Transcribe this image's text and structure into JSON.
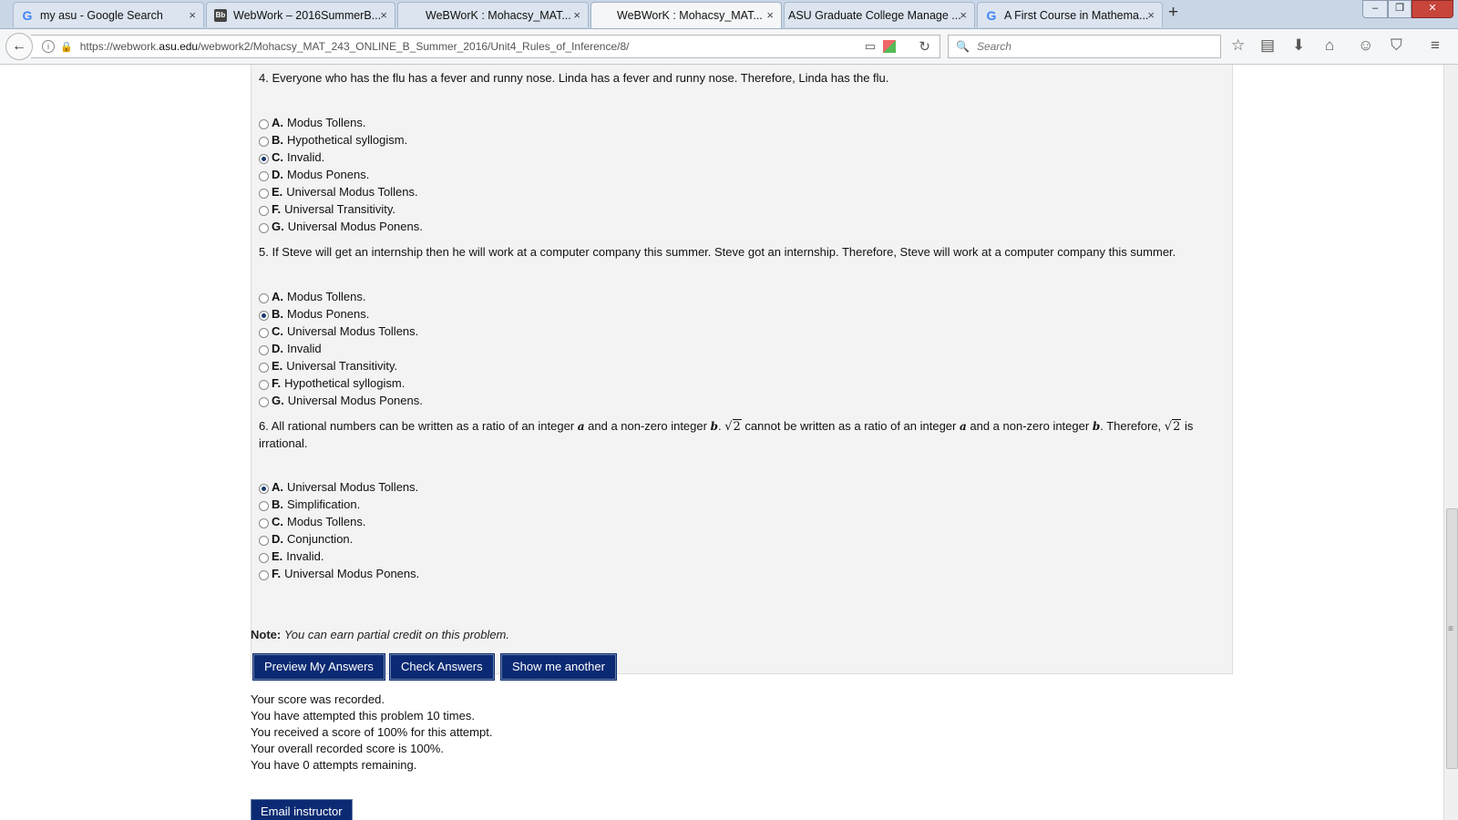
{
  "browser": {
    "tabs": [
      {
        "title": "my asu - Google Search",
        "favicon": "google-icon"
      },
      {
        "title": "WebWork – 2016SummerB...",
        "favicon": "blackboard-icon"
      },
      {
        "title": "WeBWorK : Mohacsy_MAT...",
        "favicon": "none"
      },
      {
        "title": "WeBWorK : Mohacsy_MAT...",
        "favicon": "none",
        "active": true
      },
      {
        "title": "ASU Graduate College Manage ...",
        "favicon": "none"
      },
      {
        "title": "A First Course in Mathema...",
        "favicon": "google-icon"
      }
    ],
    "close_glyph": "×",
    "new_tab_glyph": "+",
    "url_prefix": "https://webwork.",
    "url_domain": "asu.edu",
    "url_suffix": "/webwork2/Mohacsy_MAT_243_ONLINE_B_Summer_2016/Unit4_Rules_of_Inference/8/",
    "search_placeholder": "Search"
  },
  "problem": {
    "q4": {
      "text": "4. Everyone who has the flu has a fever and runny nose. Linda has a fever and runny nose. Therefore, Linda has the flu.",
      "options": [
        {
          "letter": "A.",
          "text": "Modus Tollens."
        },
        {
          "letter": "B.",
          "text": "Hypothetical syllogism."
        },
        {
          "letter": "C.",
          "text": "Invalid."
        },
        {
          "letter": "D.",
          "text": "Modus Ponens."
        },
        {
          "letter": "E.",
          "text": "Universal Modus Tollens."
        },
        {
          "letter": "F.",
          "text": "Universal Transitivity."
        },
        {
          "letter": "G.",
          "text": "Universal Modus Ponens."
        }
      ],
      "selected": "C."
    },
    "q5": {
      "text": "5. If Steve will get an internship then he will work at a computer company this summer. Steve got an internship. Therefore, Steve will work at a computer company this summer.",
      "options": [
        {
          "letter": "A.",
          "text": "Modus Tollens."
        },
        {
          "letter": "B.",
          "text": "Modus Ponens."
        },
        {
          "letter": "C.",
          "text": "Universal Modus Tollens."
        },
        {
          "letter": "D.",
          "text": "Invalid"
        },
        {
          "letter": "E.",
          "text": "Universal Transitivity."
        },
        {
          "letter": "F.",
          "text": "Hypothetical syllogism."
        },
        {
          "letter": "G.",
          "text": "Universal Modus Ponens."
        }
      ],
      "selected": "B."
    },
    "q6": {
      "part1": "6. All rational numbers can be written as a ratio of an integer ",
      "var_a": "a",
      "part2": " and a non-zero integer ",
      "var_b": "b",
      "part3": ". ",
      "sqrt_sym": "√",
      "sqrt_arg": "2",
      "part4": " cannot be written as a ratio of an integer ",
      "part5": " and a non-zero integer ",
      "part6": ". Therefore, ",
      "part7": " is irrational.",
      "options": [
        {
          "letter": "A.",
          "text": "Universal Modus Tollens."
        },
        {
          "letter": "B.",
          "text": "Simplification."
        },
        {
          "letter": "C.",
          "text": "Modus Tollens."
        },
        {
          "letter": "D.",
          "text": "Conjunction."
        },
        {
          "letter": "E.",
          "text": "Invalid."
        },
        {
          "letter": "F.",
          "text": "Universal Modus Ponens."
        }
      ],
      "selected": "A."
    }
  },
  "note": {
    "label": "Note:",
    "text": "You can earn partial credit on this problem."
  },
  "buttons": {
    "preview": "Preview My Answers",
    "check": "Check Answers",
    "another": "Show me another",
    "email": "Email instructor"
  },
  "score": [
    "Your score was recorded.",
    "You have attempted this problem 10 times.",
    "You received a score of 100% for this attempt.",
    "Your overall recorded score is 100%.",
    "You have 0 attempts remaining."
  ],
  "colors": {
    "button_bg": "#0b2a73",
    "problem_bg": "#f3f3f3"
  }
}
